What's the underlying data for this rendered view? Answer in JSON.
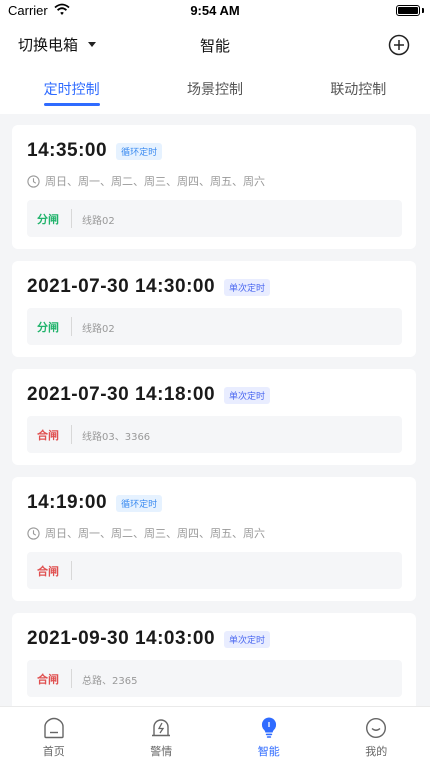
{
  "status_bar": {
    "carrier": "Carrier",
    "time": "9:54 AM"
  },
  "header": {
    "box_switch_label": "切换电箱",
    "title": "智能",
    "add_icon": "plus-circle-icon"
  },
  "tabs": [
    {
      "label": "定时控制",
      "active": true
    },
    {
      "label": "场景控制",
      "active": false
    },
    {
      "label": "联动控制",
      "active": false
    }
  ],
  "schedules": [
    {
      "time": "14:35:00",
      "tag": "循环定时",
      "weekdays": "周日、周一、周二、周三、周四、周五、周六",
      "action": "分闸",
      "lines": "线路02"
    },
    {
      "time": "2021-07-30 14:30:00",
      "tag": "单次定时",
      "action": "分闸",
      "lines": "线路02"
    },
    {
      "time": "2021-07-30 14:18:00",
      "tag": "单次定时",
      "action": "合闸",
      "lines": "线路03、3366"
    },
    {
      "time": "14:19:00",
      "tag": "循环定时",
      "weekdays": "周日、周一、周二、周三、周四、周五、周六",
      "action": "合闸",
      "lines": ""
    },
    {
      "time": "2021-09-30 14:03:00",
      "tag": "单次定时",
      "action": "合闸",
      "lines": "总路、2365"
    }
  ],
  "tabbar": [
    {
      "label": "首页",
      "icon": "home-icon",
      "active": false
    },
    {
      "label": "警情",
      "icon": "alarm-icon",
      "active": false
    },
    {
      "label": "智能",
      "icon": "bulb-icon",
      "active": true
    },
    {
      "label": "我的",
      "icon": "profile-icon",
      "active": false
    }
  ],
  "colors": {
    "accent": "#2f6bff",
    "open_action": "#20b36b",
    "close_action": "#e05050",
    "loop_tag": "#3b8bf0",
    "once_tag": "#4b68f0"
  }
}
